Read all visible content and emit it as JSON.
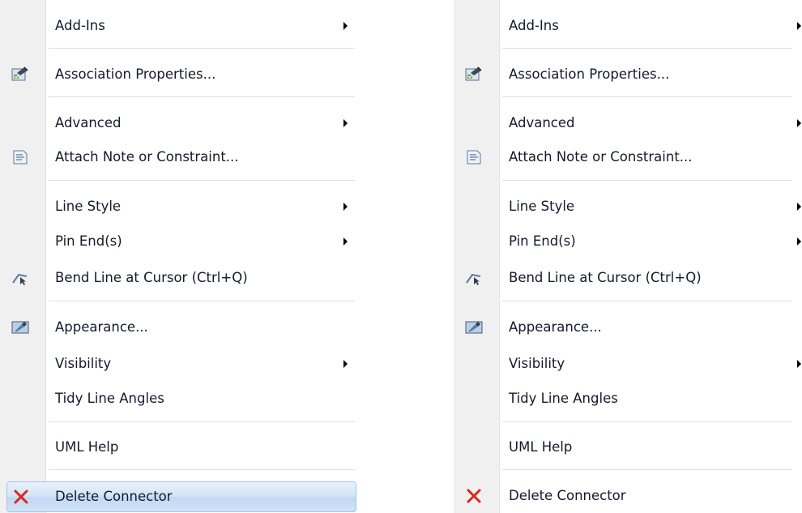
{
  "menus": [
    {
      "items": [
        {
          "label": "Add-Ins",
          "submenu": true,
          "icon": ""
        },
        {
          "label": "Association Properties...",
          "submenu": false,
          "icon": "properties-icon"
        },
        {
          "label": "Advanced",
          "submenu": true,
          "icon": ""
        },
        {
          "label": "Attach Note or Constraint...",
          "submenu": false,
          "icon": "note-icon"
        },
        {
          "label": "Line Style",
          "submenu": true,
          "icon": ""
        },
        {
          "label": "Pin End(s)",
          "submenu": true,
          "icon": ""
        },
        {
          "label": "Bend Line at Cursor (Ctrl+Q)",
          "submenu": false,
          "icon": "bend-line-icon"
        },
        {
          "label": "Appearance...",
          "submenu": false,
          "icon": "appearance-icon"
        },
        {
          "label": "Visibility",
          "submenu": true,
          "icon": ""
        },
        {
          "label": "Tidy Line Angles",
          "submenu": false,
          "icon": ""
        },
        {
          "label": "UML Help",
          "submenu": false,
          "icon": ""
        },
        {
          "label": "Delete Connector",
          "submenu": false,
          "icon": "delete-icon",
          "highlighted": true
        }
      ]
    },
    {
      "items": [
        {
          "label": "Add-Ins",
          "submenu": true,
          "icon": ""
        },
        {
          "label": "Association Properties...",
          "submenu": false,
          "icon": "properties-icon"
        },
        {
          "label": "Advanced",
          "submenu": true,
          "icon": ""
        },
        {
          "label": "Attach Note or Constraint...",
          "submenu": false,
          "icon": "note-icon"
        },
        {
          "label": "Line Style",
          "submenu": true,
          "icon": ""
        },
        {
          "label": "Pin End(s)",
          "submenu": true,
          "icon": ""
        },
        {
          "label": "Bend Line at Cursor (Ctrl+Q)",
          "submenu": false,
          "icon": "bend-line-icon"
        },
        {
          "label": "Appearance...",
          "submenu": false,
          "icon": "appearance-icon"
        },
        {
          "label": "Visibility",
          "submenu": true,
          "icon": ""
        },
        {
          "label": "Tidy Line Angles",
          "submenu": false,
          "icon": ""
        },
        {
          "label": "UML Help",
          "submenu": false,
          "icon": ""
        },
        {
          "label": "Delete Connector",
          "submenu": false,
          "icon": "delete-icon",
          "highlighted": false
        }
      ]
    }
  ],
  "colors": {
    "text": "#15192e",
    "gutter": "#f0f0f0",
    "highlight_border": "#a9c3e3",
    "delete_x": "#e0241b"
  }
}
